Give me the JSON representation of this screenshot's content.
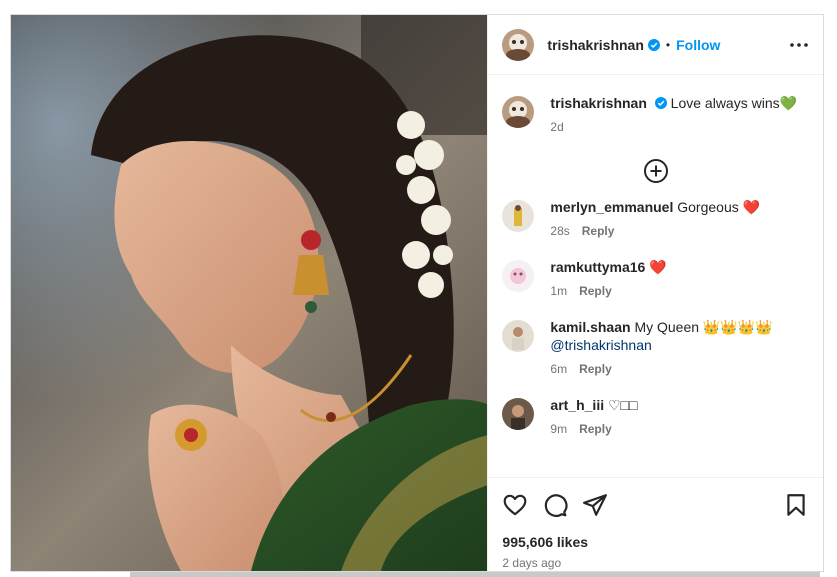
{
  "post": {
    "author": "trishakrishnan",
    "follow_label": "Follow",
    "dot": "•",
    "caption": "Love always wins💚",
    "caption_age": "2d"
  },
  "comments": [
    {
      "user": "merlyn_emmanuel",
      "text": "Gorgeous ❤️",
      "mention": "",
      "age": "28s",
      "reply": "Reply"
    },
    {
      "user": "ramkuttyma16",
      "text": "❤️",
      "mention": "",
      "age": "1m",
      "reply": "Reply"
    },
    {
      "user": "kamil.shaan",
      "text": "My Queen 👑👑👑👑",
      "mention": "@trishakrishnan",
      "age": "6m",
      "reply": "Reply"
    },
    {
      "user": "art_h_iii",
      "text": "♡□□",
      "mention": "",
      "age": "9m",
      "reply": "Reply"
    }
  ],
  "footer": {
    "likes": "995,606 likes",
    "date": "2 days ago"
  },
  "icons": {
    "more": "more-options-icon",
    "add": "plus-circle-icon",
    "like": "heart-icon",
    "comment": "comment-icon",
    "share": "share-icon",
    "save": "bookmark-icon",
    "verified": "verified-badge-icon"
  },
  "colors": {
    "accent": "#0095f6",
    "verified": "#0095f6",
    "muted": "#737373",
    "text": "#262626"
  }
}
